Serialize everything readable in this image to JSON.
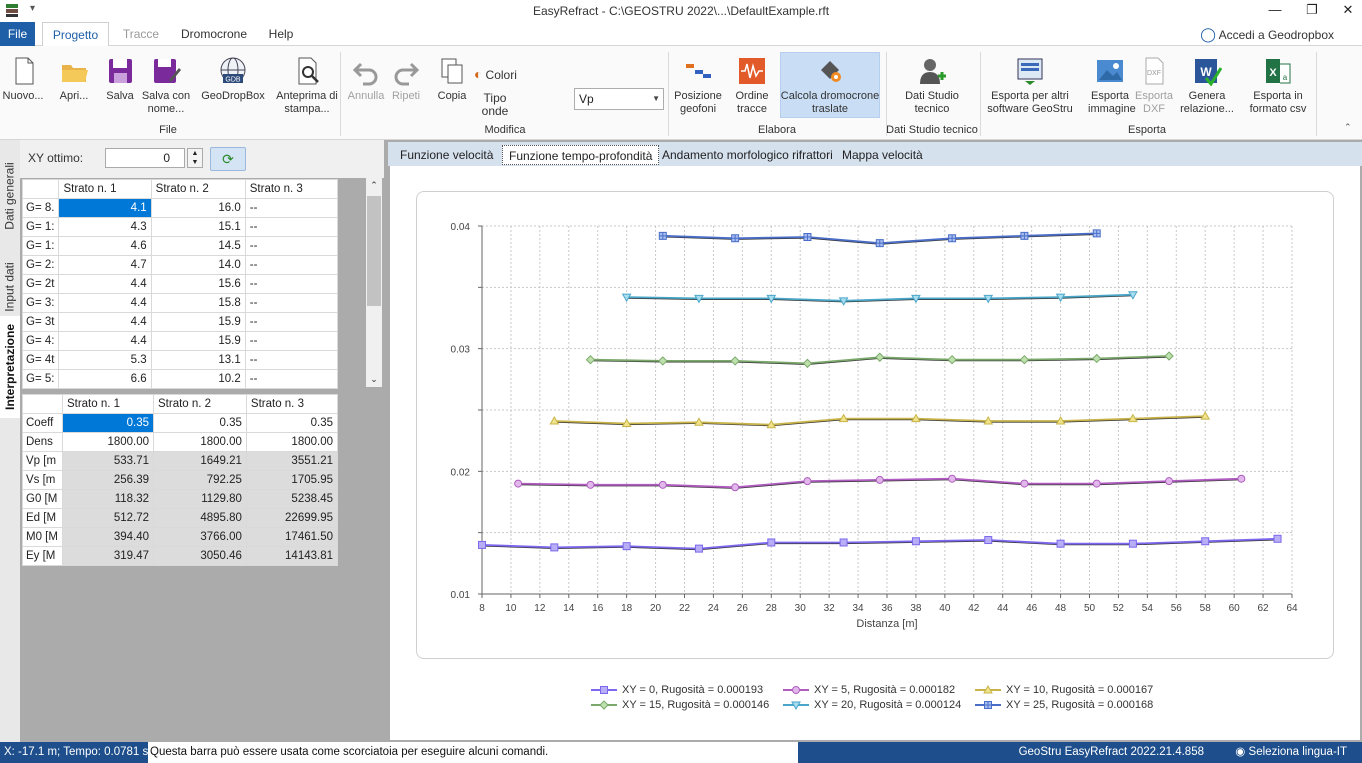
{
  "window": {
    "title": "EasyRefract - C:\\GEOSTRU 2022\\...\\DefaultExample.rft",
    "qat_label": "▾"
  },
  "menu": {
    "file": "File",
    "tabs": [
      "Progetto",
      "Tracce",
      "Dromocrone",
      "Help"
    ],
    "login": "Accedi a Geodropbox"
  },
  "ribbon": {
    "buttons": {
      "nuovo": "Nuovo...",
      "apri": "Apri...",
      "salva": "Salva",
      "salva_con_nome": "Salva con nome...",
      "geodropbox": "GeoDropBox",
      "anteprima": "Anteprima di stampa...",
      "annulla": "Annulla",
      "ripeti": "Ripeti",
      "copia": "Copia",
      "colori": "Colori",
      "tipo_onde": "Tipo onde",
      "posizione_geofoni": "Posizione geofoni",
      "ordine_tracce": "Ordine tracce",
      "calcola_dromocrone": "Calcola dromocrone traslate",
      "dati_studio": "Dati Studio tecnico",
      "esporta_software": "Esporta per altri software GeoStru",
      "esporta_immagine": "Esporta immagine",
      "esporta_dxf": "Esporta DXF",
      "genera_relazione": "Genera relazione...",
      "esporta_csv": "Esporta in formato csv"
    },
    "combo_value": "Vp",
    "groups": {
      "file": "File",
      "modifica": "Modifica",
      "elabora": "Elabora",
      "dati_studio": "Dati Studio tecnico",
      "esporta": "Esporta"
    }
  },
  "side_tabs": [
    "Dati generali",
    "Input dati",
    "Interpretazione"
  ],
  "xy": {
    "label": "XY ottimo:",
    "value": "0"
  },
  "table1": {
    "headers": [
      "",
      "Strato n. 1",
      "Strato n. 2",
      "Strato n. 3"
    ],
    "rows": [
      [
        "G= 8.",
        "4.1",
        "16.0",
        "--"
      ],
      [
        "G= 1:",
        "4.3",
        "15.1",
        "--"
      ],
      [
        "G= 1:",
        "4.6",
        "14.5",
        "--"
      ],
      [
        "G= 2:",
        "4.7",
        "14.0",
        "--"
      ],
      [
        "G= 2t",
        "4.4",
        "15.6",
        "--"
      ],
      [
        "G= 3:",
        "4.4",
        "15.8",
        "--"
      ],
      [
        "G= 3t",
        "4.4",
        "15.9",
        "--"
      ],
      [
        "G= 4:",
        "4.4",
        "15.9",
        "--"
      ],
      [
        "G= 4t",
        "5.3",
        "13.1",
        "--"
      ],
      [
        "G= 5:",
        "6.6",
        "10.2",
        "--"
      ]
    ]
  },
  "table2": {
    "headers": [
      "",
      "Strato n. 1",
      "Strato n. 2",
      "Strato n. 3"
    ],
    "rows": [
      [
        "Coeff",
        "0.35",
        "0.35",
        "0.35"
      ],
      [
        "Dens",
        "1800.00",
        "1800.00",
        "1800.00"
      ],
      [
        "Vp [m",
        "533.71",
        "1649.21",
        "3551.21"
      ],
      [
        "Vs [m",
        "256.39",
        "792.25",
        "1705.95"
      ],
      [
        "G0 [M",
        "118.32",
        "1129.80",
        "5238.45"
      ],
      [
        "Ed [M",
        "512.72",
        "4895.80",
        "22699.95"
      ],
      [
        "M0 [M",
        "394.40",
        "3766.00",
        "17461.50"
      ],
      [
        "Ey [M",
        "319.47",
        "3050.46",
        "14143.81"
      ]
    ]
  },
  "content_tabs": [
    "Funzione velocità",
    "Funzione tempo-profondità",
    "Andamento morfologico rifrattori",
    "Mappa velocità"
  ],
  "chart_data": {
    "type": "line",
    "xlabel": "Distanza [m]",
    "ylabel": "",
    "xlim": [
      8,
      64
    ],
    "ylim": [
      0.01,
      0.04
    ],
    "xticks": [
      "8",
      "10",
      "12",
      "14",
      "16",
      "18",
      "20",
      "22",
      "24",
      "26",
      "28",
      "30",
      "32",
      "34",
      "36",
      "38",
      "40",
      "42",
      "44",
      "46",
      "48",
      "50",
      "52",
      "54",
      "56",
      "58",
      "60",
      "62",
      "64"
    ],
    "yticks": [
      "0.01",
      "0.02",
      "0.03",
      "0.04"
    ],
    "grid": true,
    "legend_position": "bottom",
    "series": [
      {
        "name": "XY = 0, Rugosità = 0.000193",
        "color": "#7b68ee",
        "marker": "square",
        "x": [
          8,
          13,
          18,
          23,
          28,
          33,
          38,
          43,
          48,
          53,
          58,
          63
        ],
        "y": [
          0.014,
          0.0138,
          0.0139,
          0.0137,
          0.0142,
          0.0142,
          0.0143,
          0.0144,
          0.0141,
          0.0141,
          0.0143,
          0.0145
        ]
      },
      {
        "name": "XY = 5, Rugosità = 0.000182",
        "color": "#b05cc0",
        "marker": "circle",
        "x": [
          10.5,
          15.5,
          20.5,
          25.5,
          30.5,
          35.5,
          40.5,
          45.5,
          50.5,
          55.5,
          60.5
        ],
        "y": [
          0.019,
          0.0189,
          0.0189,
          0.0187,
          0.0192,
          0.0193,
          0.0194,
          0.019,
          0.019,
          0.0192,
          0.0194
        ]
      },
      {
        "name": "XY = 10, Rugosità = 0.000167",
        "color": "#c8b44a",
        "marker": "triangle",
        "x": [
          13,
          18,
          23,
          28,
          33,
          38,
          43,
          48,
          53,
          58
        ],
        "y": [
          0.0241,
          0.0239,
          0.024,
          0.0238,
          0.0243,
          0.0243,
          0.0241,
          0.0241,
          0.0243,
          0.0245
        ]
      },
      {
        "name": "XY = 15, Rugosità = 0.000146",
        "color": "#7aa86a",
        "marker": "diamond",
        "x": [
          15.5,
          20.5,
          25.5,
          30.5,
          35.5,
          40.5,
          45.5,
          50.5,
          55.5
        ],
        "y": [
          0.0291,
          0.029,
          0.029,
          0.0288,
          0.0293,
          0.0291,
          0.0291,
          0.0292,
          0.0294
        ]
      },
      {
        "name": "XY = 20, Rugosità = 0.000124",
        "color": "#4aa6c8",
        "marker": "triangle-down",
        "x": [
          18,
          23,
          28,
          33,
          38,
          43,
          48,
          53
        ],
        "y": [
          0.0342,
          0.0341,
          0.0341,
          0.0339,
          0.0341,
          0.0341,
          0.0342,
          0.0344
        ]
      },
      {
        "name": "XY = 25, Rugosità = 0.000168",
        "color": "#4a6ec8",
        "marker": "star",
        "x": [
          20.5,
          25.5,
          30.5,
          35.5,
          40.5,
          45.5,
          50.5
        ],
        "y": [
          0.0392,
          0.039,
          0.0391,
          0.0386,
          0.039,
          0.0392,
          0.0394
        ]
      }
    ]
  },
  "status": {
    "coords": "X: -17.1 m; Tempo: 0.0781 s",
    "hint": "Questa barra può essere usata come scorciatoia per eseguire alcuni comandi.",
    "version": "GeoStru EasyRefract 2022.21.4.858",
    "language": "Seleziona lingua-IT"
  }
}
